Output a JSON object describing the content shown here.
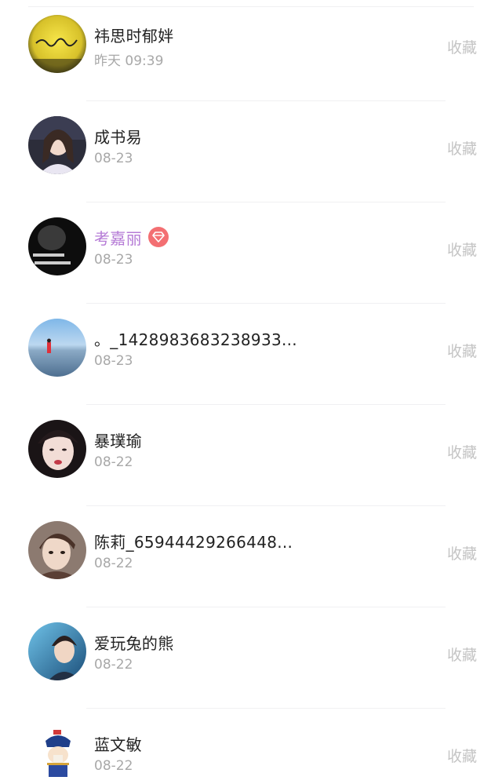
{
  "list": {
    "items": [
      {
        "name": "祎思时郁姅",
        "date": "昨天 09:39",
        "action": "收藏",
        "vip": false,
        "avatar": "yellow-art-avatar"
      },
      {
        "name": "成书易",
        "date": "08-23",
        "action": "收藏",
        "vip": false,
        "avatar": "girl-portrait-avatar"
      },
      {
        "name": "考嘉丽",
        "date": "08-23",
        "action": "收藏",
        "vip": true,
        "avatar": "dark-text-avatar",
        "name_color": "#b57bd6",
        "badge_color": "#f36f72"
      },
      {
        "name": "。_1428983683238933...",
        "date": "08-23",
        "action": "收藏",
        "vip": false,
        "avatar": "beach-scene-avatar"
      },
      {
        "name": "暴璞瑜",
        "date": "08-22",
        "action": "收藏",
        "vip": false,
        "avatar": "girl-closeup-avatar"
      },
      {
        "name": "陈莉_65944429266448...",
        "date": "08-22",
        "action": "收藏",
        "vip": false,
        "avatar": "boy-portrait-avatar"
      },
      {
        "name": "爱玩兔的熊",
        "date": "08-22",
        "action": "收藏",
        "vip": false,
        "avatar": "blue-portrait-avatar"
      },
      {
        "name": "蓝文敏",
        "date": "08-22",
        "action": "收藏",
        "vip": false,
        "avatar": "cartoon-avatar"
      }
    ]
  },
  "colors": {
    "name": "#222222",
    "date": "#a8a8a8",
    "action": "#c4c4c4",
    "vip_name": "#b57bd6",
    "vip_badge": "#f36f72"
  }
}
